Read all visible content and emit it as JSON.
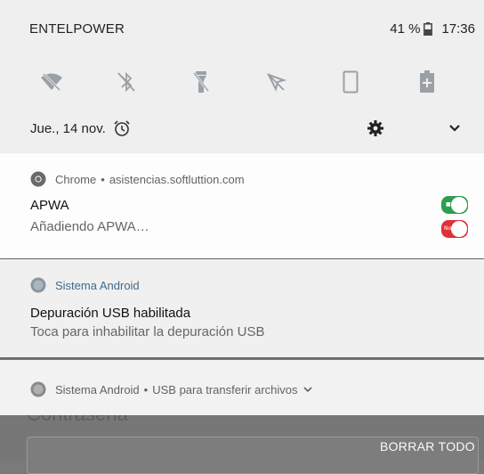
{
  "status_bar": {
    "carrier": "ENTELPOWER",
    "battery_percent": "41 %",
    "time": "17:36"
  },
  "quick_settings": [
    {
      "icon": "wifi-off-icon"
    },
    {
      "icon": "bluetooth-off-icon"
    },
    {
      "icon": "flashlight-off-icon"
    },
    {
      "icon": "location-off-icon"
    },
    {
      "icon": "auto-rotate-icon"
    },
    {
      "icon": "battery-saver-icon"
    }
  ],
  "shade_header": {
    "date": "Jue., 14 nov."
  },
  "notifications": [
    {
      "app": "Chrome",
      "sub": "asistencias.softluttion.com",
      "title": "APWA",
      "text": "Añadiendo APWA…"
    },
    {
      "app": "Sistema Android",
      "title": "Depuración USB habilitada",
      "text": "Toca para inhabilitar la depuración USB"
    },
    {
      "app": "Sistema Android",
      "sub": "USB para transferir archivos"
    }
  ],
  "background": {
    "label": "Contraseña"
  },
  "clear_all": "BORRAR TODO",
  "colors": {
    "toggle_on": "#2e9d52",
    "toggle_off": "#e0303a",
    "shade_bg": "#efefef"
  }
}
